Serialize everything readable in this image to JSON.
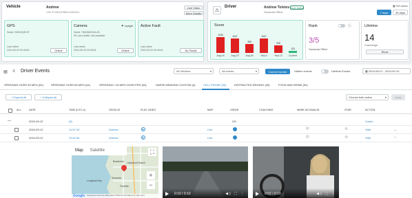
{
  "vehicle": {
    "label": "Vehicle",
    "name": "Andrew",
    "vin": "VIN 4T1BZ1FB6KU038412",
    "live_video": "Live Video",
    "more_details": "More Details",
    "gps": {
      "title": "GPS",
      "sub1": "Serial: G9N1SQECR",
      "sub2": "Last online",
      "sub3": "2024-09-20 09:45:40",
      "status": "Online"
    },
    "camera": {
      "title": "Camera",
      "sub1": "Serial: 7K8QN5GS4LZD",
      "sub2": "SD card health: Not available",
      "sub3": "Last online",
      "sub4": "2024-09-20 09:45:04",
      "uplight": "Uplight",
      "status": "Online"
    },
    "fault": {
      "title": "Active Fault",
      "sub1": "Last online",
      "sub2": "2024-09-20 09:45:40",
      "status": "No Faults"
    }
  },
  "driver": {
    "label": "Driver",
    "name": "Andrew Tolstov",
    "office": "Sarasota Office",
    "live_video": "Live video",
    "calendar_label": "Set dates",
    "days7": "7 days",
    "days30": "30 days",
    "score": {
      "title": "Score",
      "bars": [
        {
          "value": "1150",
          "label": "Aug 16",
          "height_frac": 0.95,
          "color": "#e02020"
        },
        {
          "value": "1047",
          "label": "Aug 23",
          "height_frac": 0.86,
          "color": "#e02020"
        },
        {
          "value": "355",
          "label": "Aug 30",
          "height_frac": 0.55,
          "color": "#e02020"
        },
        {
          "value": "1047",
          "label": "Sep 6",
          "height_frac": 0.86,
          "color": "#e02020"
        },
        {
          "value": "205",
          "label": "Sep 13",
          "height_frac": 0.44,
          "color": "#e02020"
        },
        {
          "value": "123",
          "label": "Current",
          "height_frac": 0.12,
          "color": "#2fb57c"
        }
      ]
    },
    "rank": {
      "title": "Rank",
      "value": "3/5",
      "sub": "Sarasota Office",
      "info": "ⓘ"
    },
    "lifetime": {
      "title": "Lifetime",
      "value": "14",
      "sub": "Coachings",
      "show": "Show"
    }
  },
  "events": {
    "title": "Driver Events",
    "vehicles_select": "All Vehicles",
    "events_select": "All events",
    "current_events": "Current events",
    "hidden_events": "Hidden events",
    "lifetime_events": "Lifetime Events",
    "date_range": "2024-08-21 - 2024-09-19",
    "tabs": [
      {
        "label": "SPEEDING OVER 90 MPH (52)"
      },
      {
        "label": "SPEEDING OVER 80 MPH (44)"
      },
      {
        "label": "SPEEDING +15 MPH OVER PRS (53)"
      },
      {
        "label": "HARSH BRAKING CUSTOM (4)"
      },
      {
        "label": "CELL PHONE (50)"
      },
      {
        "label": "DISTRACTED DRIVING (45)"
      },
      {
        "label": "FOOD AND DRINK (52)"
      }
    ],
    "expand_all": "+ Expand all",
    "collapse_all": "− Collapse all",
    "bulk_action": "Choose bulk action",
    "apply": "Apply",
    "columns": {
      "all": "ALL",
      "date": "DATE",
      "time": "TIME (UTC-4)",
      "vehicle": "VEHICLE",
      "play": "PLAY VIDEO",
      "map": "MAP",
      "views": "VIEWS",
      "coaching": "COACHING",
      "invalid": "MARK AS INVALID",
      "star": "STAR",
      "action": "ACTION"
    },
    "rows": [
      {
        "date": "2024-09-12",
        "time": "(5)",
        "vehicle": "",
        "map": "",
        "views": "2/5",
        "action": "Coach"
      },
      {
        "date": "2024-09-12",
        "time": "11:57:15",
        "vehicle": "Andrew",
        "map": "Link",
        "views": "",
        "action": "Hide"
      },
      {
        "date": "2024-09-12",
        "time": "11:40:45",
        "vehicle": "Andrew",
        "map": "Link",
        "views": "",
        "action": "Hide"
      }
    ]
  },
  "map": {
    "tab_map": "Map",
    "tab_satellite": "Satellite",
    "footer": "Keyboard shortcuts  Map data ©2024  Terms  Report a map error",
    "google": "Google",
    "labels": [
      "Lakewood Ranch",
      "Bradenton",
      "Sarasota",
      "Longboat Key",
      "Fruitville"
    ]
  },
  "videos": [
    {
      "time": "0:10 / 0:10"
    },
    {
      "time": "0:02 / 0:10"
    }
  ]
}
